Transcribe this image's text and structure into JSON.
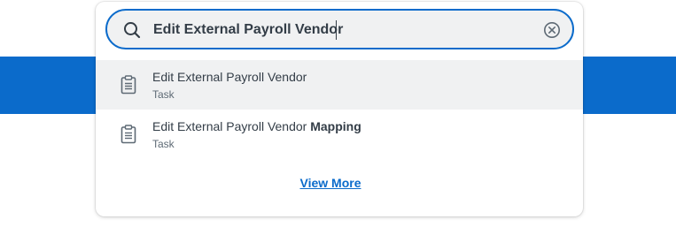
{
  "search": {
    "query": "Edit External Payroll Vendor",
    "icon": "search-icon",
    "clear_icon": "clear-circle-icon"
  },
  "results": [
    {
      "title_prefix": "Edit External Payroll Vendor",
      "title_highlight": "",
      "type": "Task",
      "icon": "clipboard-icon",
      "highlighted": true
    },
    {
      "title_prefix": "Edit External Payroll Vendor ",
      "title_highlight": "Mapping",
      "type": "Task",
      "icon": "clipboard-icon",
      "highlighted": false
    }
  ],
  "view_more_label": "View More",
  "colors": {
    "accent": "#0b6bcb",
    "row_highlight": "#f0f1f2",
    "text": "#333d47"
  }
}
